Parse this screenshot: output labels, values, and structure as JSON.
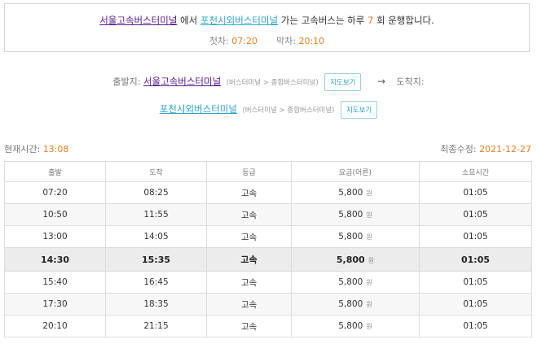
{
  "summary": {
    "origin": "서울고속버스터미널",
    "particle_from": "에서",
    "destination": "포천시외버스터미널",
    "text_runs": "가는 고속버스는 하루",
    "count": "7",
    "text_end": "회 운행합니다.",
    "first_label": "첫차:",
    "first_time": "07:20",
    "last_label": "막차:",
    "last_time": "20:10"
  },
  "route": {
    "origin_label": "출발지:",
    "origin_name": "서울고속버스터미널",
    "origin_sub": "(버스터미널 > 종합버스터미널)",
    "map_button": "지도보기",
    "arrow": "→",
    "dest_label": "도착지:",
    "dest_name": "포천시외버스터미널",
    "dest_sub": "(버스터미널 > 종합버스터미널)"
  },
  "meta": {
    "current_label": "현재시간:",
    "current_time": "13:08",
    "updated_label": "최종수정:",
    "updated_date": "2021-12-27"
  },
  "table": {
    "headers": [
      "출발",
      "도착",
      "등급",
      "요금(어른)",
      "소요시간"
    ],
    "won": "원",
    "rows": [
      {
        "dep": "07:20",
        "arr": "08:25",
        "grade": "고속",
        "fare": "5,800",
        "dur": "01:05"
      },
      {
        "dep": "10:50",
        "arr": "11:55",
        "grade": "고속",
        "fare": "5,800",
        "dur": "01:05"
      },
      {
        "dep": "13:00",
        "arr": "14:05",
        "grade": "고속",
        "fare": "5,800",
        "dur": "01:05"
      },
      {
        "dep": "14:30",
        "arr": "15:35",
        "grade": "고속",
        "fare": "5,800",
        "dur": "01:05"
      },
      {
        "dep": "15:40",
        "arr": "16:45",
        "grade": "고속",
        "fare": "5,800",
        "dur": "01:05"
      },
      {
        "dep": "17:30",
        "arr": "18:35",
        "grade": "고속",
        "fare": "5,800",
        "dur": "01:05"
      },
      {
        "dep": "20:10",
        "arr": "21:15",
        "grade": "고속",
        "fare": "5,800",
        "dur": "01:05"
      }
    ]
  },
  "colors": {
    "accent_orange": "#e67e22",
    "link_blue": "#2fa4c5",
    "link_visited": "#551a8b"
  }
}
